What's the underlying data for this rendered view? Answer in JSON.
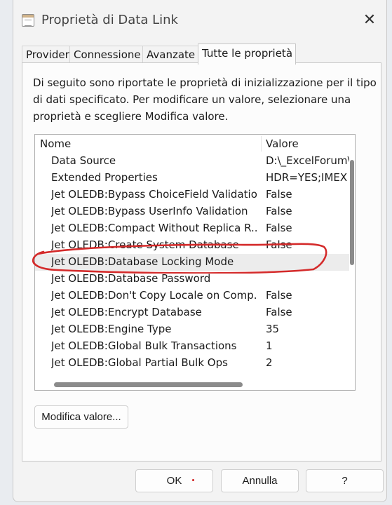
{
  "window": {
    "title": "Proprietà di Data Link",
    "close_glyph": "✕"
  },
  "tabs": [
    {
      "label": "Provider"
    },
    {
      "label": "Connessione"
    },
    {
      "label": "Avanzate"
    },
    {
      "label": "Tutte le proprietà",
      "active": true
    }
  ],
  "description": "Di seguito sono riportate le proprietà di inizializzazione per il tipo di dati specificato. Per modificare un valore, selezionare una proprietà e scegliere Modifica valore.",
  "list": {
    "columns": {
      "name": "Nome",
      "value": "Valore"
    },
    "rows": [
      {
        "name": "Data Source",
        "value": "D:\\_ExcelForum\\l"
      },
      {
        "name": "Extended Properties",
        "value": "HDR=YES;IMEX"
      },
      {
        "name": "Jet OLEDB:Bypass ChoiceField Validation",
        "value": "False"
      },
      {
        "name": "Jet OLEDB:Bypass UserInfo Validation",
        "value": "False"
      },
      {
        "name": "Jet OLEDB:Compact Without Replica R...",
        "value": "False"
      },
      {
        "name": "Jet OLEDB:Create System Database",
        "value": "False"
      },
      {
        "name": "Jet OLEDB:Database Locking Mode",
        "value": "",
        "selected": true
      },
      {
        "name": "Jet OLEDB:Database Password",
        "value": ""
      },
      {
        "name": "Jet OLEDB:Don't Copy Locale on Comp...",
        "value": "False"
      },
      {
        "name": "Jet OLEDB:Encrypt Database",
        "value": "False"
      },
      {
        "name": "Jet OLEDB:Engine Type",
        "value": "35"
      },
      {
        "name": "Jet OLEDB:Global Bulk Transactions",
        "value": "1"
      },
      {
        "name": "Jet OLEDB:Global Partial Bulk Ops",
        "value": "2"
      }
    ]
  },
  "buttons": {
    "modify": "Modifica valore...",
    "ok": "OK",
    "cancel": "Annulla",
    "help": "?"
  },
  "colors": {
    "annotation": "#d42a2a",
    "scroll_thumb": "#8b8b8b"
  }
}
